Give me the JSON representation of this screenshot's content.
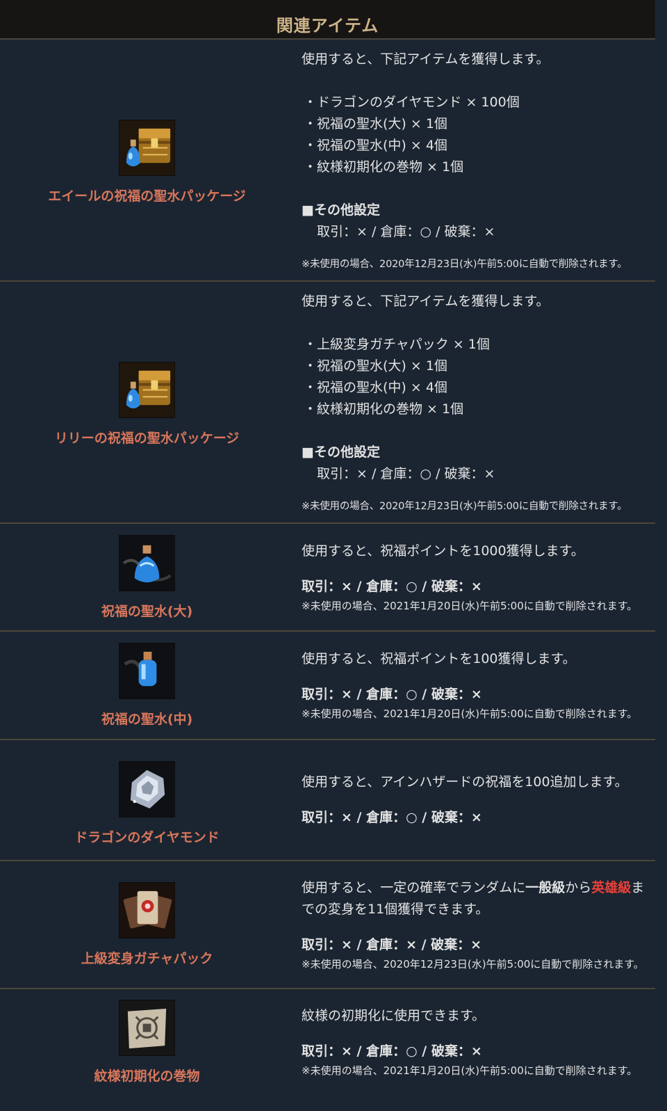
{
  "header": {
    "title": "関連アイテム"
  },
  "items": [
    {
      "name": "エイールの祝福の聖水パッケージ",
      "icon": "chest-potion-icon",
      "intro": "使用すると、下記アイテムを獲得します。",
      "contents": [
        "・ドラゴンのダイヤモンド × 100個",
        "・祝福の聖水(大) × 1個",
        "・祝福の聖水(中) × 4個",
        "・紋様初期化の巻物 × 1個"
      ],
      "settings_title": "■その他設定",
      "settings": "取引：× / 倉庫：○ / 破棄：×",
      "note": "※未使用の場合、2020年12月23日(水)午前5:00に自動で削除されます。"
    },
    {
      "name": "リリーの祝福の聖水パッケージ",
      "icon": "chest-potion-icon",
      "intro": "使用すると、下記アイテムを獲得します。",
      "contents": [
        "・上級変身ガチャパック × 1個",
        "・祝福の聖水(大) × 1個",
        "・祝福の聖水(中) × 4個",
        "・紋様初期化の巻物 × 1個"
      ],
      "settings_title": "■その他設定",
      "settings": "取引：× / 倉庫：○ / 破棄：×",
      "note": "※未使用の場合、2020年12月23日(水)午前5:00に自動で削除されます。"
    },
    {
      "name": "祝福の聖水(大)",
      "icon": "large-potion-icon",
      "desc": "使用すると、祝福ポイントを1000獲得します。",
      "trade": "取引：× / 倉庫：○ / 破棄：×",
      "note": "※未使用の場合、2021年1月20日(水)午前5:00に自動で削除されます。"
    },
    {
      "name": "祝福の聖水(中)",
      "icon": "medium-potion-icon",
      "desc": "使用すると、祝福ポイントを100獲得します。",
      "trade": "取引：× / 倉庫：○ / 破棄：×",
      "note": "※未使用の場合、2021年1月20日(水)午前5:00に自動で削除されます。"
    },
    {
      "name": "ドラゴンのダイヤモンド",
      "icon": "diamond-icon",
      "desc": "使用すると、アインハザードの祝福を100追加します。",
      "trade": "取引：× / 倉庫：○ / 破棄：×"
    },
    {
      "name": "上級変身ガチャパック",
      "icon": "card-pack-icon",
      "desc_pre": "使用すると、一定の確率でランダムに",
      "desc_bold": "一般級",
      "desc_mid": "から",
      "desc_red": "英雄級",
      "desc_post": "までの変身を11個獲得できます。",
      "trade": "取引：× / 倉庫：× / 破棄：×",
      "note": "※未使用の場合、2020年12月23日(水)午前5:00に自動で削除されます。"
    },
    {
      "name": "紋様初期化の巻物",
      "icon": "scroll-icon",
      "desc": "紋様の初期化に使用できます。",
      "trade": "取引：× / 倉庫：○ / 破棄：×",
      "note": "※未使用の場合、2021年1月20日(水)午前5:00に自動で削除されます。"
    }
  ],
  "colors": {
    "name": "#d9765b",
    "accent_red": "#e8413a",
    "header_text": "#cdb38a",
    "background": "#1b2531"
  }
}
